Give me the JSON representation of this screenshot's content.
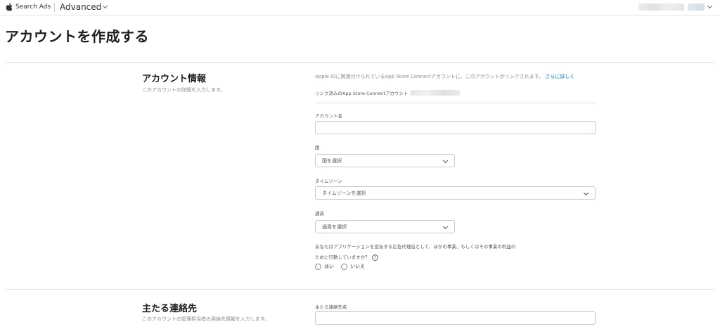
{
  "topbar": {
    "brand": "Search Ads",
    "product": "Advanced"
  },
  "page": {
    "title": "アカウントを作成する"
  },
  "account_info": {
    "title": "アカウント情報",
    "subtitle": "このアカウントの詳細を入力します。",
    "intro": "Apple IDに関連付けられているApp Store Connectアカウントに、このアカウントがリンクされます。",
    "learn_more": "さらに詳しく",
    "linked_label": "リンク済みのApp Store Connectアカウント",
    "account_name_label": "アカウント名",
    "account_name_value": "",
    "country_label": "国",
    "country_placeholder": "国を選択",
    "timezone_label": "タイムゾーン",
    "timezone_placeholder": "タイムゾーンを選択",
    "currency_label": "通貨",
    "currency_placeholder": "通貨を選択",
    "agency_question_line1": "あなたはアプリケーションを宣伝する広告代理店として、ほかの事業、もしくはその事業の利益の",
    "agency_question_line2": "ために行動していますか？",
    "help_glyph": "?",
    "option_yes": "はい",
    "option_no": "いいえ"
  },
  "primary_contact": {
    "title": "主たる連絡先",
    "subtitle": "このアカウントの管理担当者の連絡先情報を入力します。",
    "contact_name_label": "主たる連絡先名",
    "contact_name_value": ""
  },
  "icons": {
    "apple": "apple-logo-icon",
    "dropdown": "chevron-down-icon",
    "help": "help-circle-icon"
  },
  "colors": {
    "link": "#0070c9",
    "text": "#1d1d1f",
    "muted": "#8a8a8a",
    "border": "#c8c8c8"
  }
}
